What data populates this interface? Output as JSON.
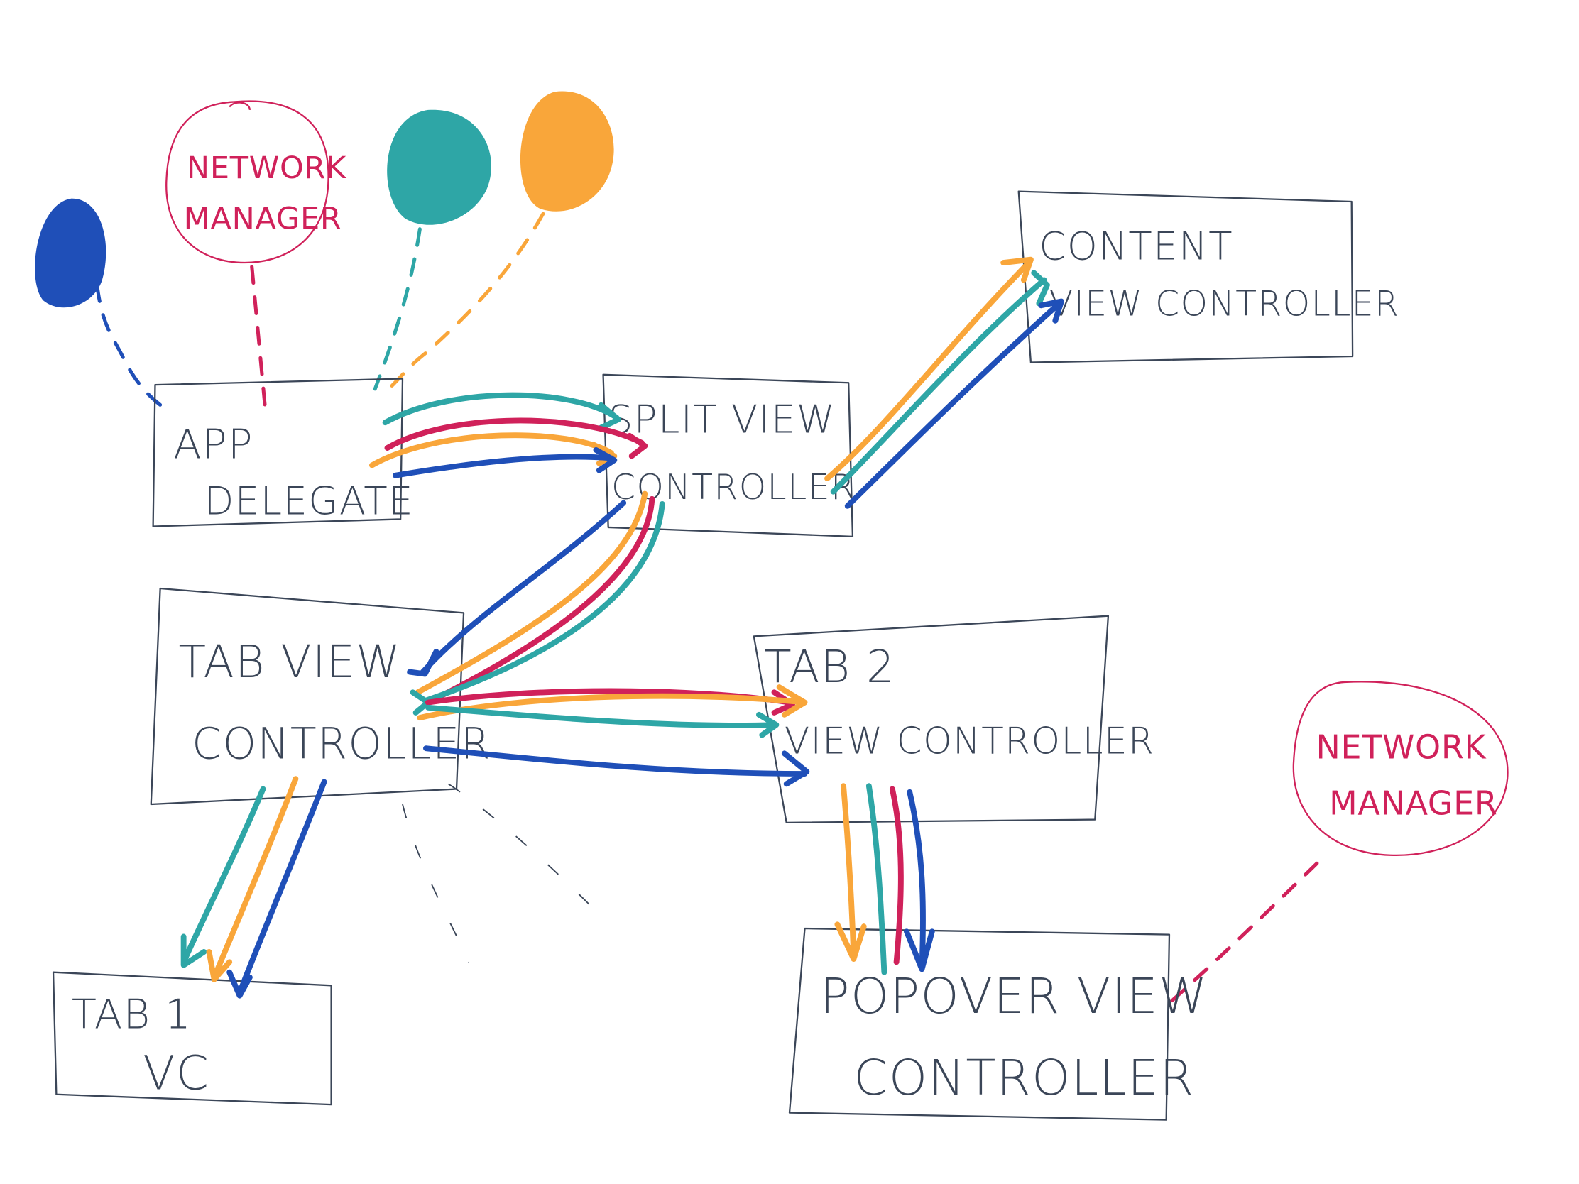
{
  "colors": {
    "outline": "#3b4658",
    "blue": "#1f4fb8",
    "teal": "#2ea6a6",
    "orange": "#f9a63a",
    "red": "#d0215a"
  },
  "nodes": {
    "app_delegate": {
      "line1": "APP",
      "line2": "DELEGATE"
    },
    "split_view": {
      "line1": "SPLIT VIEW",
      "line2": "CONTROLLER"
    },
    "content_view": {
      "line1": "CONTENT",
      "line2": "VIEW CONTROLLER"
    },
    "tab_view": {
      "line1": "TAB VIEW",
      "line2": "CONTROLLER"
    },
    "tab2_view": {
      "line1": "TAB 2",
      "line2": "VIEW CONTROLLER"
    },
    "tab1_vc": {
      "line1": "TAB 1",
      "line2": "VC"
    },
    "popover_view": {
      "line1": "POPOVER VIEW",
      "line2": "CONTROLLER"
    },
    "network_manager_top": {
      "line1": "NETWORK",
      "line2": "MANAGER"
    },
    "network_manager_right": {
      "line1": "NETWORK",
      "line2": "MANAGER"
    }
  },
  "balloons": [
    "blue",
    "teal",
    "orange"
  ]
}
